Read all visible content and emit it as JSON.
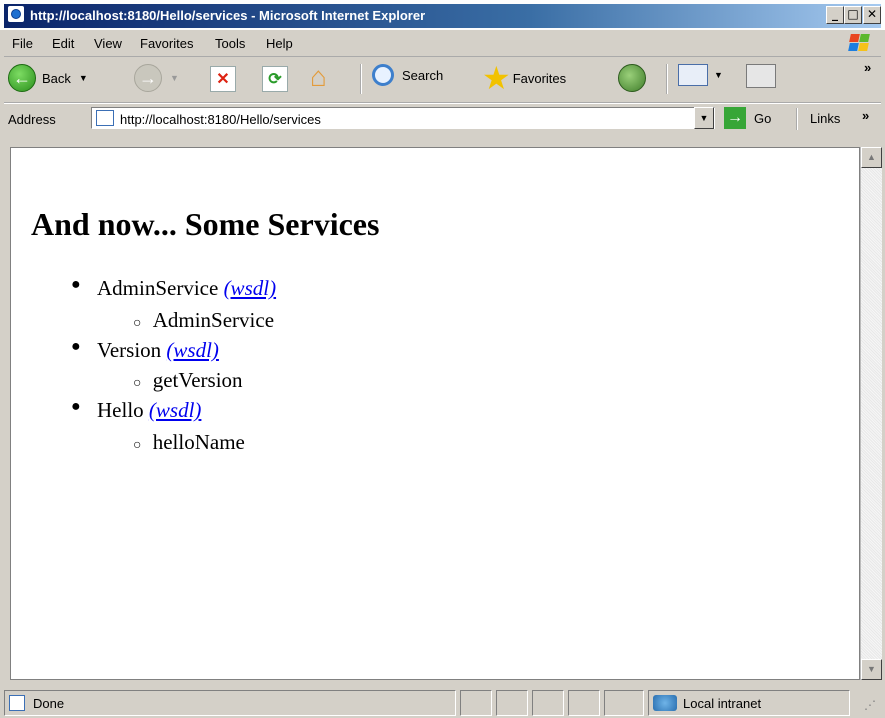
{
  "window": {
    "title": "http://localhost:8180/Hello/services - Microsoft Internet Explorer"
  },
  "menu": {
    "items": [
      "File",
      "Edit",
      "View",
      "Favorites",
      "Tools",
      "Help"
    ]
  },
  "toolbar": {
    "back_label": "Back",
    "search_label": "Search",
    "favorites_label": "Favorites"
  },
  "address": {
    "label": "Address",
    "value": "http://localhost:8180/Hello/services",
    "go_label": "Go",
    "links_label": "Links"
  },
  "page": {
    "heading": "And now... Some Services",
    "services": [
      {
        "name": "AdminService",
        "wsdl_label": "(wsdl)",
        "methods": [
          "AdminService"
        ]
      },
      {
        "name": "Version",
        "wsdl_label": "(wsdl)",
        "methods": [
          "getVersion"
        ]
      },
      {
        "name": "Hello",
        "wsdl_label": "(wsdl)",
        "methods": [
          "helloName"
        ]
      }
    ]
  },
  "status": {
    "text": "Done",
    "zone": "Local intranet"
  }
}
